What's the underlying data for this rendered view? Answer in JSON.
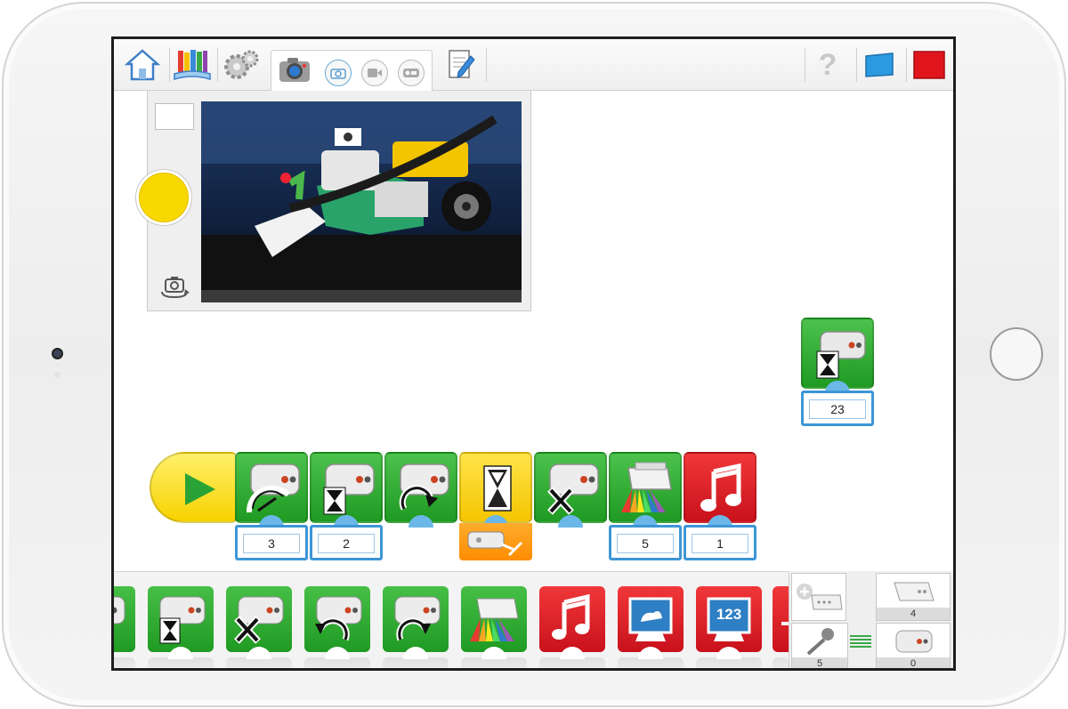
{
  "colors": {
    "accent_blue": "#3d96d6",
    "block_green": "#24a028",
    "block_red": "#d8141f",
    "block_yellow": "#f7d200",
    "block_orange": "#ff9200"
  },
  "toolbar": {
    "icons": [
      "home-icon",
      "library-icon",
      "settings-gears-icon",
      "camera-tab-icon",
      "photo-mode-icon",
      "video-mode-icon",
      "record-mode-icon",
      "document-icon",
      "help-icon",
      "blue-display-icon",
      "red-stop-icon"
    ],
    "help_glyph": "?"
  },
  "program": {
    "main_sequence": [
      {
        "type": "play",
        "icon": "play-icon"
      },
      {
        "type": "motor-power",
        "icon": "motor-power-icon",
        "param": "3"
      },
      {
        "type": "motor-on-for",
        "icon": "motor-hourglass-icon",
        "param": "2"
      },
      {
        "type": "motor-direction",
        "icon": "motor-rotate-cw-icon"
      },
      {
        "type": "wait-for",
        "icon": "hourglass-icon",
        "param_icon": "tilt-sensor-icon"
      },
      {
        "type": "motor-off",
        "icon": "motor-off-icon"
      },
      {
        "type": "hub-light",
        "icon": "hub-light-color-icon",
        "param": "5"
      },
      {
        "type": "play-sound",
        "icon": "music-note-icon",
        "param": "1"
      }
    ],
    "floating_block": {
      "type": "motor-on-for",
      "icon": "motor-hourglass-icon",
      "param": "23"
    }
  },
  "palette": {
    "blocks": [
      {
        "color": "green",
        "icon": "motor-partial-icon"
      },
      {
        "color": "green",
        "icon": "motor-hourglass-icon"
      },
      {
        "color": "green",
        "icon": "motor-off-icon"
      },
      {
        "color": "green",
        "icon": "motor-rotate-ccw-icon"
      },
      {
        "color": "green",
        "icon": "motor-rotate-cw-icon"
      },
      {
        "color": "green",
        "icon": "hub-light-color-icon"
      },
      {
        "color": "red",
        "icon": "music-note-icon"
      },
      {
        "color": "red",
        "icon": "display-image-icon"
      },
      {
        "color": "red",
        "icon": "display-number-icon",
        "label": "123"
      },
      {
        "color": "red",
        "icon": "display-partial-icon"
      }
    ],
    "devices": {
      "connect_hub_icon": "add-hub-icon",
      "hub_count": "4",
      "mic_count": "5",
      "motor_count": "0"
    }
  }
}
